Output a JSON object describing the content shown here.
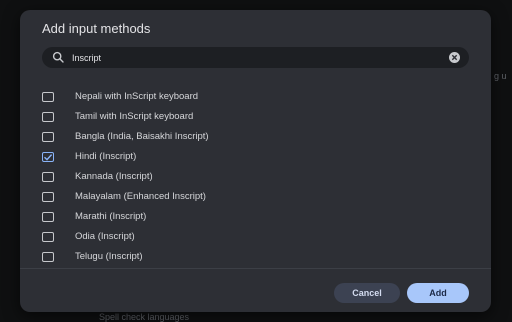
{
  "dialog": {
    "title": "Add input methods",
    "search": {
      "value": "Inscript",
      "placeholder": ""
    },
    "items": [
      {
        "label": "Nepali with InScript keyboard",
        "checked": false
      },
      {
        "label": "Tamil with InScript keyboard",
        "checked": false
      },
      {
        "label": "Bangla (India, Baisakhi Inscript)",
        "checked": false
      },
      {
        "label": "Hindi (Inscript)",
        "checked": true
      },
      {
        "label": "Kannada (Inscript)",
        "checked": false
      },
      {
        "label": "Malayalam (Enhanced Inscript)",
        "checked": false
      },
      {
        "label": "Marathi (Inscript)",
        "checked": false
      },
      {
        "label": "Odia (Inscript)",
        "checked": false
      },
      {
        "label": "Telugu (Inscript)",
        "checked": false
      }
    ],
    "cancel_label": "Cancel",
    "add_label": "Add"
  },
  "background": {
    "right_fragment": "g u",
    "bottom_fragment": "Spell check languages"
  },
  "colors": {
    "dialog_bg": "#2d2f35",
    "accent": "#a8c7fa",
    "checkbox_checked": "#8ab4f8"
  }
}
